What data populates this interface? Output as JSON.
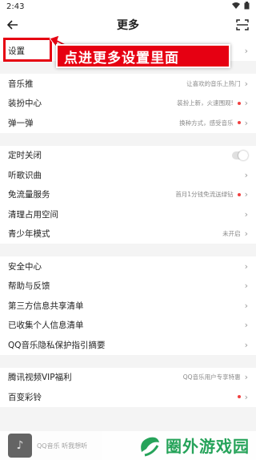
{
  "status": {
    "time": "2:43"
  },
  "header": {
    "title": "更多"
  },
  "annotation": {
    "callout_text": "点进更多设置里面"
  },
  "sections": [
    {
      "items": [
        {
          "label": "设置"
        }
      ]
    },
    {
      "items": [
        {
          "label": "音乐推",
          "hint": "让喜欢的音乐上热门"
        },
        {
          "label": "装扮中心",
          "hint": "装扮上新，火速围观!",
          "badge": "dot"
        },
        {
          "label": "弹一弹",
          "hint": "换种方式，感受音乐",
          "badge": "dot"
        }
      ]
    },
    {
      "items": [
        {
          "label": "定时关闭",
          "control": "toggle",
          "toggle_on": false
        },
        {
          "label": "听歌识曲"
        },
        {
          "label": "免流量服务",
          "hint": "首月1分钱免流送绿钻",
          "badge": "dot"
        },
        {
          "label": "清理占用空间"
        },
        {
          "label": "青少年模式",
          "hint": "未开启"
        }
      ]
    },
    {
      "items": [
        {
          "label": "安全中心"
        },
        {
          "label": "帮助与反馈"
        },
        {
          "label": "第三方信息共享清单"
        },
        {
          "label": "已收集个人信息清单"
        },
        {
          "label": "QQ音乐隐私保护指引摘要"
        }
      ]
    },
    {
      "items": [
        {
          "label": "腾讯视频VIP福利",
          "hint": "QQ音乐用户专享特惠"
        },
        {
          "label": "百变彩铃",
          "badge": "dot"
        }
      ]
    }
  ],
  "mini_player": {
    "text": "QQ音乐 听我想听"
  },
  "watermark": {
    "text": "圈外游戏园"
  },
  "colors": {
    "annotation_red": "#e60012",
    "badge_red": "#f04040",
    "watermark_green": "#26a35a"
  }
}
